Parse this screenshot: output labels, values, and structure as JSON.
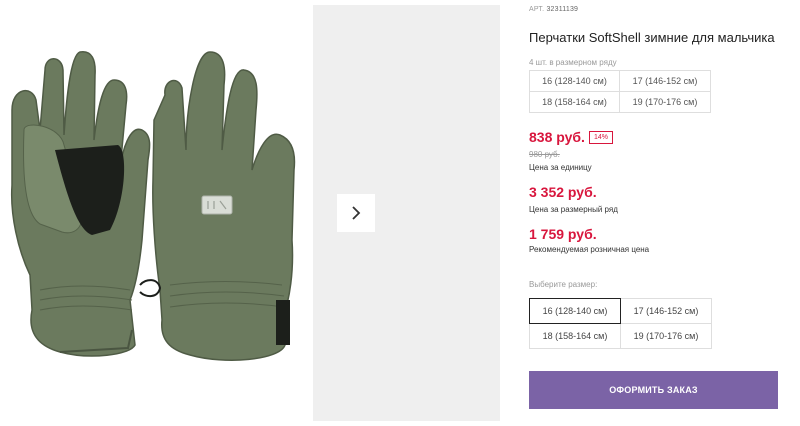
{
  "product": {
    "article_label": "АРТ.",
    "article_number": "32311139",
    "title": "Перчатки SoftShell зимние для мальчика",
    "pack_note": "4 шт. в размерном ряду",
    "pack_sizes": [
      "16 (128-140 см)",
      "17 (146-152 см)",
      "18 (158-164 см)",
      "19 (170-176 см)"
    ]
  },
  "pricing": {
    "unit_price": "838 руб.",
    "discount": "14%",
    "old_price": "980 руб.",
    "unit_label": "Цена за единицу",
    "size_row_price": "3 352 руб.",
    "size_row_label": "Цена за размерный ряд",
    "retail_price": "1 759 руб.",
    "retail_label": "Рекомендуемая розничная цена"
  },
  "size_select": {
    "label": "Выберите размер:",
    "options": [
      "16 (128-140 см)",
      "17 (146-152 см)",
      "18 (158-164 см)",
      "19 (170-176 см)"
    ],
    "selected": "16 (128-140 см)"
  },
  "actions": {
    "order_label": "ОФОРМИТЬ ЗАКАЗ"
  },
  "gallery": {
    "next_icon": "chevron-right-icon",
    "product_image": "olive-green-softshell-gloves-pair"
  },
  "colors": {
    "accent": "#7b63a6",
    "price": "#d8163d",
    "glove": "#6b7a5e"
  }
}
